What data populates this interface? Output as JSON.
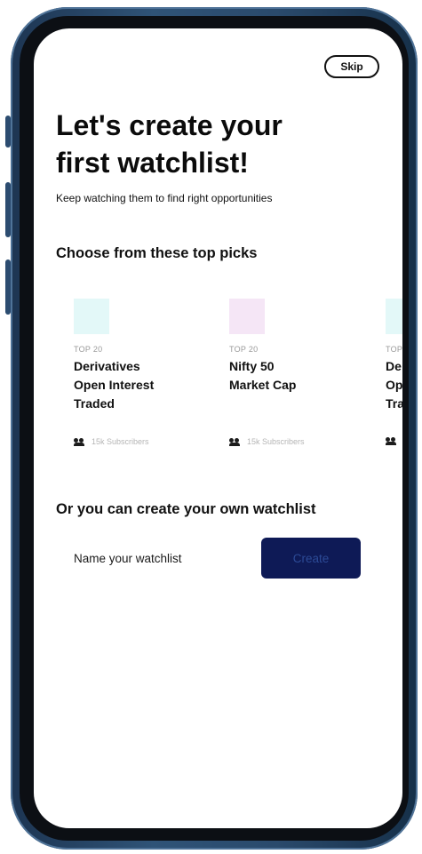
{
  "header": {
    "skip_label": "Skip"
  },
  "hero": {
    "title_line1": "Let's create your",
    "title_line2": "first watchlist!",
    "subtitle": "Keep watching them to find right opportunities"
  },
  "top_picks": {
    "heading": "Choose from these top picks",
    "cards": [
      {
        "tag": "TOP 20",
        "name_line1": "Derivatives",
        "name_line2": "Open Interest",
        "name_line3": "Traded",
        "subscribers": "15k Subscribers",
        "thumb_color": "#e3f8f8"
      },
      {
        "tag": "TOP 20",
        "name_line1": "Nifty 50",
        "name_line2": "Market Cap",
        "name_line3": "",
        "subscribers": "15k Subscribers",
        "thumb_color": "#f5e6f6"
      },
      {
        "tag": "TOP",
        "name_line1": "De",
        "name_line2": "Op",
        "name_line3": "Tra",
        "subscribers": "",
        "thumb_color": "#e3f8f8"
      }
    ]
  },
  "own": {
    "heading": "Or you can create your own watchlist",
    "input_placeholder": "Name your watchlist",
    "create_label": "Create"
  }
}
